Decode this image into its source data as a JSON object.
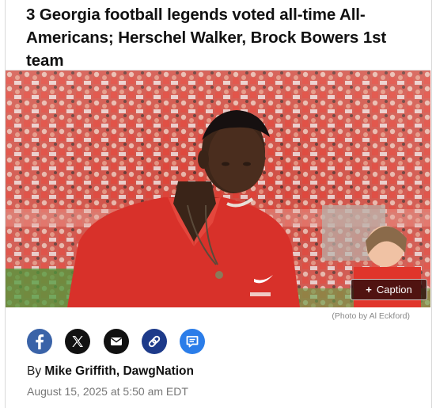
{
  "article": {
    "headline": "3 Georgia football legends voted all-time All-Americans; Herschel Walker, Brock Bowers 1st team",
    "photo_credit": "(Photo by Al Eckford)",
    "caption_button_label": "Caption",
    "caption_button_plus": "+",
    "byline_prefix": "By",
    "author": "Mike Griffith, DawgNation",
    "date": "August 15, 2025 at 5:50 am EDT"
  },
  "share_buttons": [
    {
      "name": "facebook",
      "icon": "facebook-icon",
      "color": "#3a63a8"
    },
    {
      "name": "x",
      "icon": "x-icon",
      "color": "#111111"
    },
    {
      "name": "email",
      "icon": "email-icon",
      "color": "#111111"
    },
    {
      "name": "link",
      "icon": "link-icon",
      "color": "#1d3a8a"
    },
    {
      "name": "comment",
      "icon": "comment-icon",
      "color": "#2b7de9"
    }
  ],
  "colors": {
    "shirt_red": "#d8312a",
    "crowd_red": "#c94a3f"
  }
}
